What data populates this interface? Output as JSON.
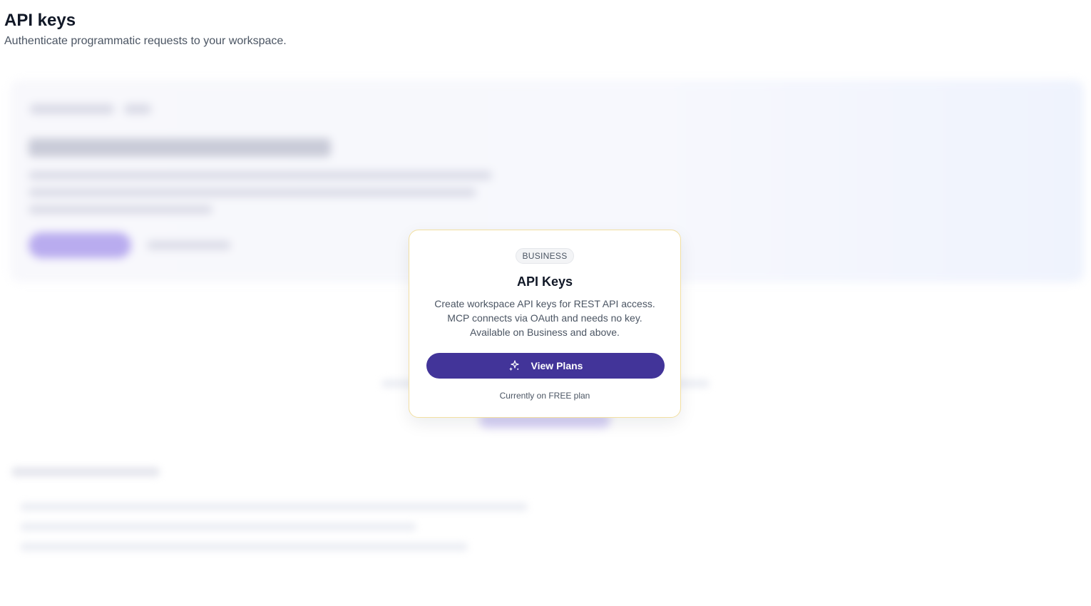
{
  "page": {
    "title": "API keys",
    "subtitle": "Authenticate programmatic requests to your workspace."
  },
  "upgrade_card": {
    "badge": "BUSINESS",
    "title": "API Keys",
    "body_lines": [
      "Create workspace API keys for REST API access.",
      "MCP connects via OAuth and needs no key.",
      "Available on Business and above."
    ],
    "button_label": "View Plans",
    "button_icon": "sparkle-icon",
    "status": "Currently on FREE plan"
  },
  "colors": {
    "accent": "#423499",
    "card_border": "#f2dfa1",
    "badge_bg": "#f3f4f6"
  }
}
